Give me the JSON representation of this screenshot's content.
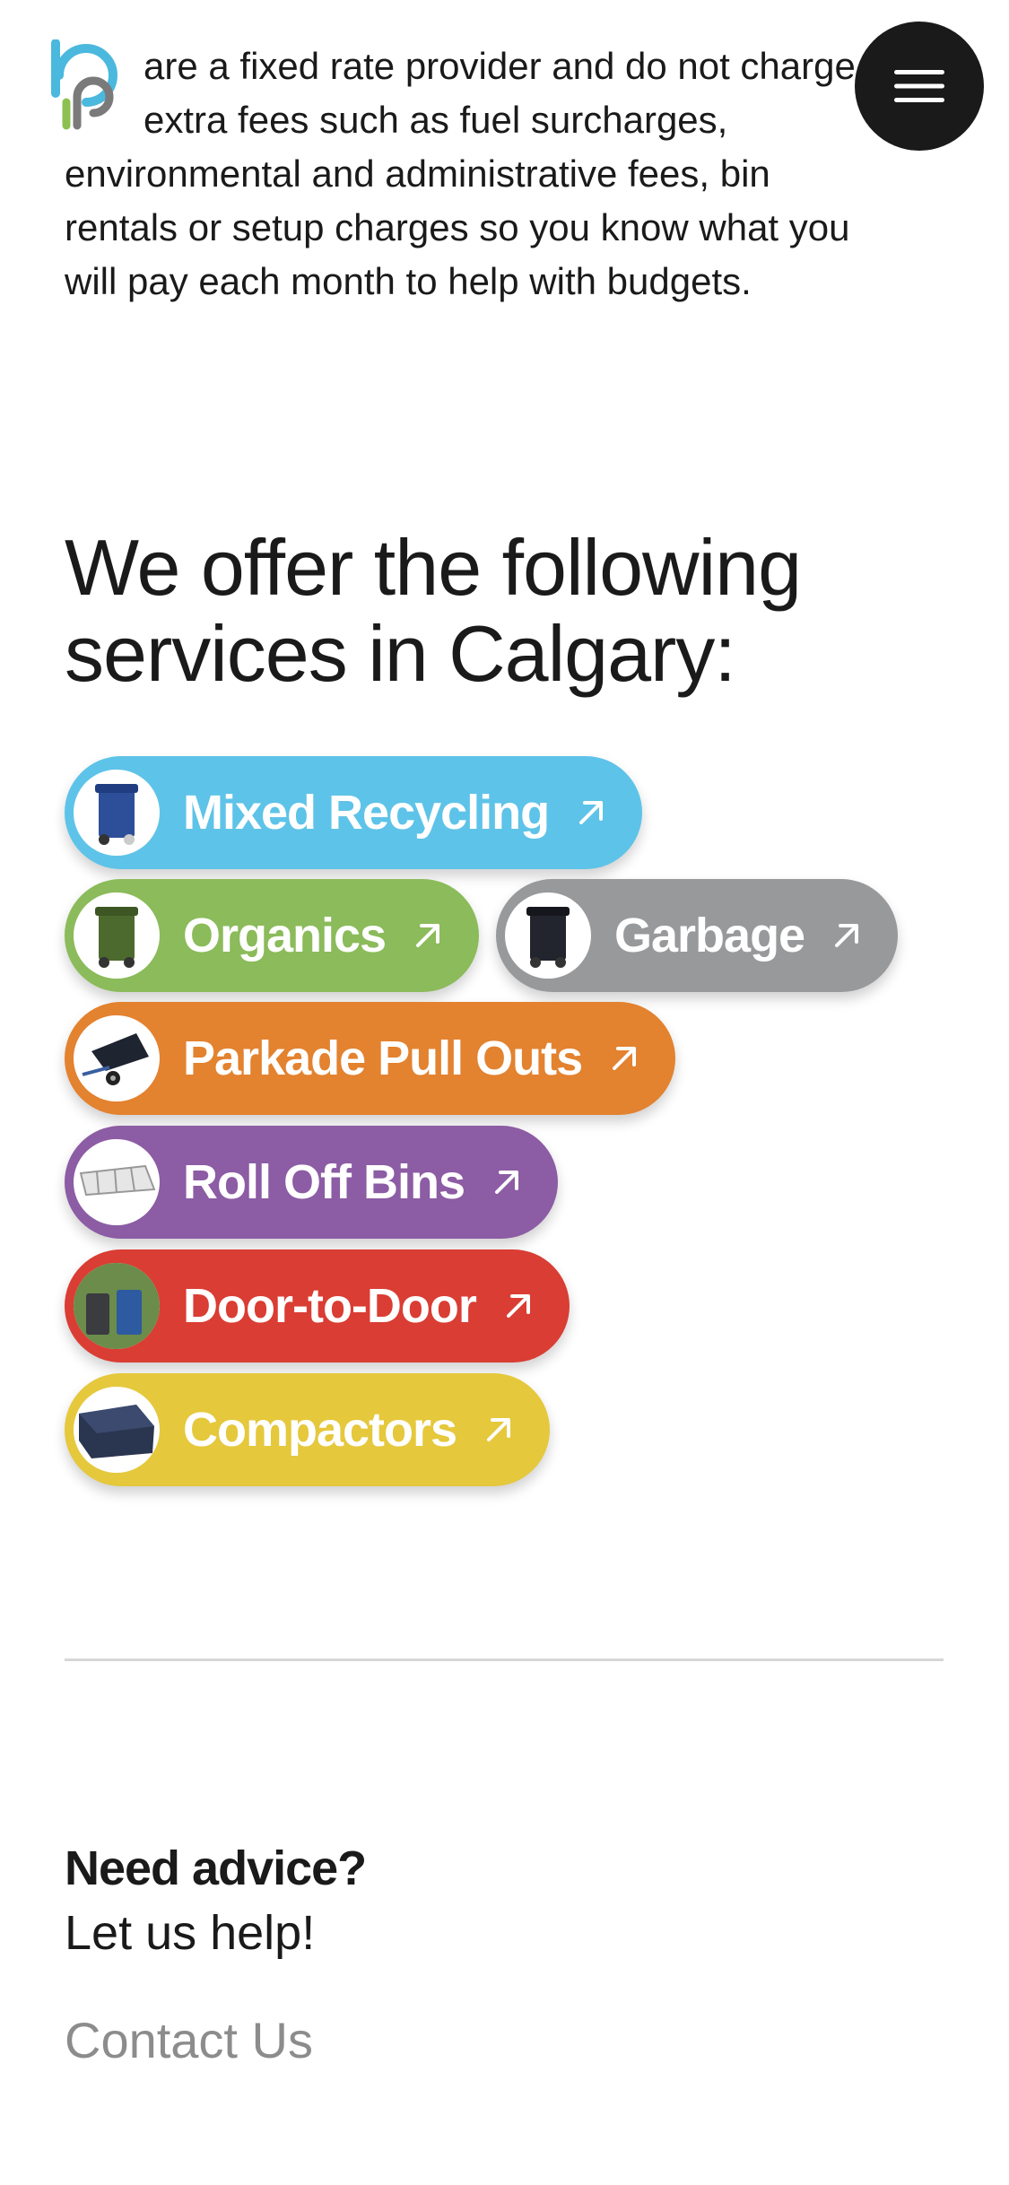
{
  "intro": {
    "lines": [
      "are a fixed rate provider and do not charge",
      "extra fees such as fuel surcharges,",
      "environmental and administrative fees, bin",
      "rentals or setup charges so you know what you",
      "will pay each month to help with budgets."
    ]
  },
  "header": {
    "logo_icon": "company-logo",
    "menu_icon": "hamburger-menu-icon"
  },
  "services": {
    "heading_line1": "We offer the following",
    "heading_line2": "services in Calgary:",
    "items": [
      {
        "label": "Mixed Recycling",
        "color": "#5ec3e8",
        "thumb": "blue-recycling-cart"
      },
      {
        "label": "Organics",
        "color": "#8bbb5a",
        "thumb": "green-organics-cart"
      },
      {
        "label": "Garbage",
        "color": "#98999b",
        "thumb": "black-garbage-cart"
      },
      {
        "label": "Parkade Pull Outs",
        "color": "#e3822f",
        "thumb": "trailer-cart"
      },
      {
        "label": "Roll Off Bins",
        "color": "#8c5ca4",
        "thumb": "roll-off-bin"
      },
      {
        "label": "Door-to-Door",
        "color": "#da3d33",
        "thumb": "curbside-carts"
      },
      {
        "label": "Compactors",
        "color": "#e5c83c",
        "thumb": "compactor-unit"
      }
    ]
  },
  "advice": {
    "title": "Need advice?",
    "subtitle": "Let us help!",
    "contact_label": "Contact Us"
  }
}
